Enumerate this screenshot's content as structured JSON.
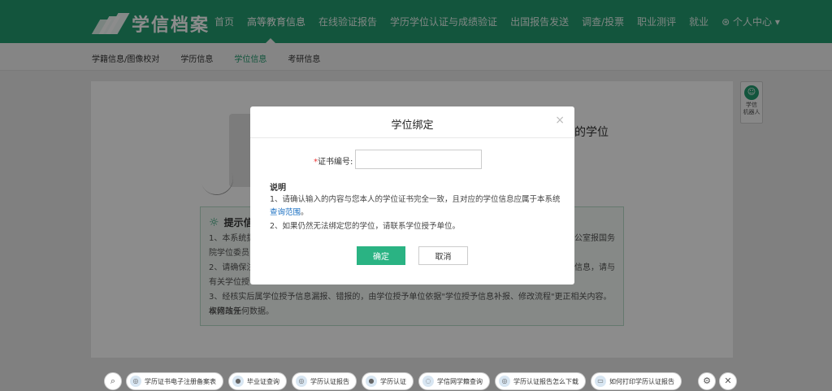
{
  "header": {
    "logo_text": "学信档案",
    "nav": [
      "首页",
      "高等教育信息",
      "在线验证报告",
      "学历学位认证与成绩验证",
      "出国报告发送",
      "调查/投票",
      "职业测评",
      "就业",
      "⊛ 个人中心 ▾"
    ]
  },
  "subnav": [
    "学籍信息/图像校对",
    "学历信息",
    "学位信息",
    "考研信息"
  ],
  "background": {
    "right_text": "的学位",
    "tips_title": "提示信",
    "tips": [
      "1、本系统提",
      "院学位委员",
      "2、请确保注",
      "有关学位授",
      "3、经核实后属学位授予信息漏报、错报的，由学位授予单位依据\"学位授予信息补报、修改流程\"更正相关内容。本网站无",
      "权修改任何数据。"
    ],
    "tips_right": [
      "公室报国务",
      "信息，请与"
    ]
  },
  "robot": {
    "label_1": "学信",
    "label_2": "机器人"
  },
  "modal": {
    "title": "学位绑定",
    "close": "×",
    "field_label": "证书编号:",
    "required_mark": "*",
    "field_value": "",
    "desc_heading": "说明",
    "desc_1": "1、请确认输入的内容与您本人的学位证书完全一致，且对应的学位信息应属于本系统",
    "desc_link": "查询范围",
    "desc_link_suffix": "。",
    "desc_2": "2、如果仍然无法绑定您的学位，请联系学位授予单位。",
    "ok": "确定",
    "cancel": "取消"
  },
  "bottom_chips": [
    "学历证书电子注册备案表",
    "毕业证查询",
    "学历认证报告",
    "学历认证",
    "学信网学籍查询",
    "学历认证报告怎么下载",
    "如何打印学历认证报告"
  ],
  "colors": {
    "brand": "#239b6f",
    "button": "#2ab383",
    "link": "#1a6fc2"
  }
}
